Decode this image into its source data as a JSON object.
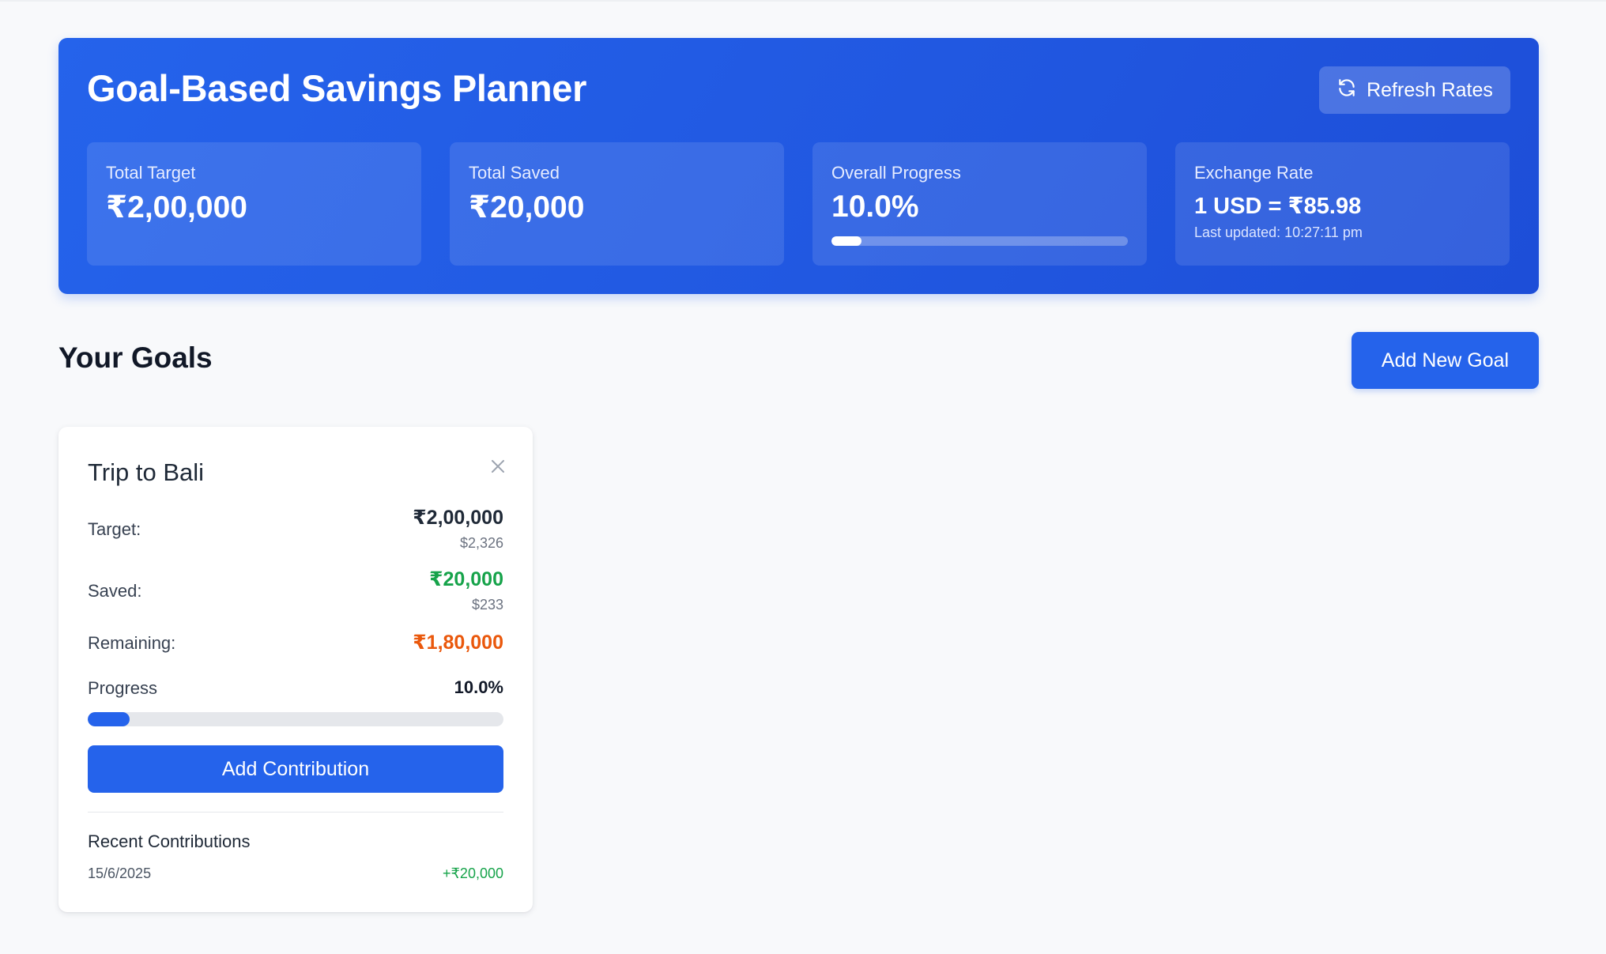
{
  "header": {
    "title": "Goal-Based Savings Planner",
    "refresh_label": "Refresh Rates",
    "refresh_icon": "refresh-icon",
    "stats": {
      "total_target": {
        "label": "Total Target",
        "value": "₹2,00,000"
      },
      "total_saved": {
        "label": "Total Saved",
        "value": "₹20,000"
      },
      "overall_progress": {
        "label": "Overall Progress",
        "value": "10.0%",
        "fraction": 0.1
      },
      "exchange_rate": {
        "label": "Exchange Rate",
        "value": "1 USD = ₹85.98",
        "updated": "Last updated: 10:27:11 pm"
      }
    }
  },
  "goals_section": {
    "title": "Your Goals",
    "add_goal_label": "Add New Goal"
  },
  "goals": [
    {
      "name": "Trip to Bali",
      "close_icon": "close-icon",
      "target_label": "Target:",
      "target_inr": "₹2,00,000",
      "target_usd": "$2,326",
      "saved_label": "Saved:",
      "saved_inr": "₹20,000",
      "saved_usd": "$233",
      "remaining_label": "Remaining:",
      "remaining_inr": "₹1,80,000",
      "progress_label": "Progress",
      "progress_value": "10.0%",
      "progress_fraction": 0.1,
      "contribution_button": "Add Contribution",
      "recent_title": "Recent Contributions",
      "contributions": [
        {
          "date": "15/6/2025",
          "amount": "+₹20,000"
        }
      ]
    }
  ],
  "colors": {
    "primary": "#2563eb",
    "saved": "#16a34a",
    "remaining": "#ea580c",
    "background": "#f8f9fb"
  }
}
